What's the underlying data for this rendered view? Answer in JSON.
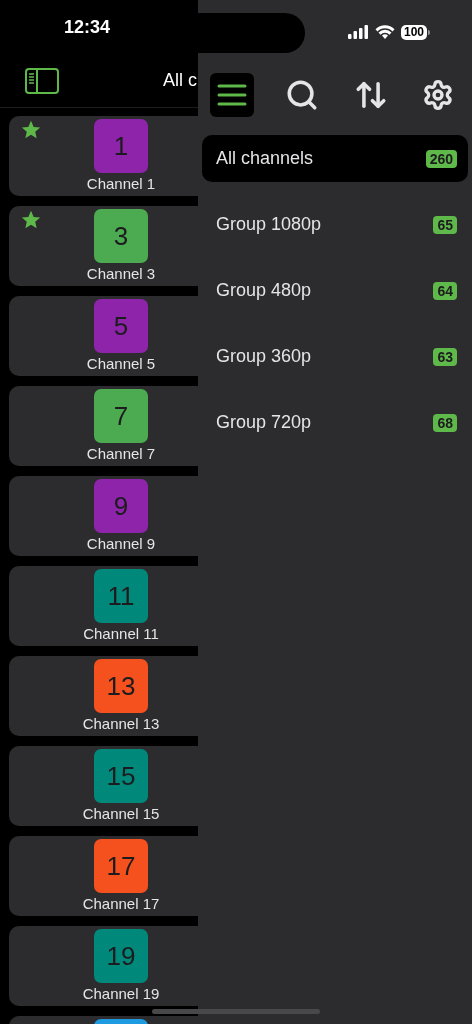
{
  "status_bar": {
    "time": "12:34",
    "battery": "100"
  },
  "header": {
    "title": "All c"
  },
  "channels": [
    {
      "number": "1",
      "name": "Channel 1",
      "color": "#8e24aa",
      "favorite": true
    },
    {
      "number": "3",
      "name": "Channel 3",
      "color": "#4caa50",
      "favorite": true
    },
    {
      "number": "5",
      "name": "Channel 5",
      "color": "#8e24aa",
      "favorite": false
    },
    {
      "number": "7",
      "name": "Channel 7",
      "color": "#4caa50",
      "favorite": false
    },
    {
      "number": "9",
      "name": "Channel 9",
      "color": "#8e24aa",
      "favorite": false
    },
    {
      "number": "11",
      "name": "Channel 11",
      "color": "#00897b",
      "favorite": false
    },
    {
      "number": "13",
      "name": "Channel 13",
      "color": "#f4511e",
      "favorite": false
    },
    {
      "number": "15",
      "name": "Channel 15",
      "color": "#00897b",
      "favorite": false
    },
    {
      "number": "17",
      "name": "Channel 17",
      "color": "#f4511e",
      "favorite": false
    },
    {
      "number": "19",
      "name": "Channel 19",
      "color": "#00897b",
      "favorite": false
    },
    {
      "color": "#1e9be0"
    }
  ],
  "drawer": {
    "groups": [
      {
        "label": "All channels",
        "count": "260",
        "selected": true
      },
      {
        "label": "Group 1080p",
        "count": "65",
        "selected": false
      },
      {
        "label": "Group 480p",
        "count": "64",
        "selected": false
      },
      {
        "label": "Group 360p",
        "count": "63",
        "selected": false
      },
      {
        "label": "Group 720p",
        "count": "68",
        "selected": false
      }
    ]
  }
}
